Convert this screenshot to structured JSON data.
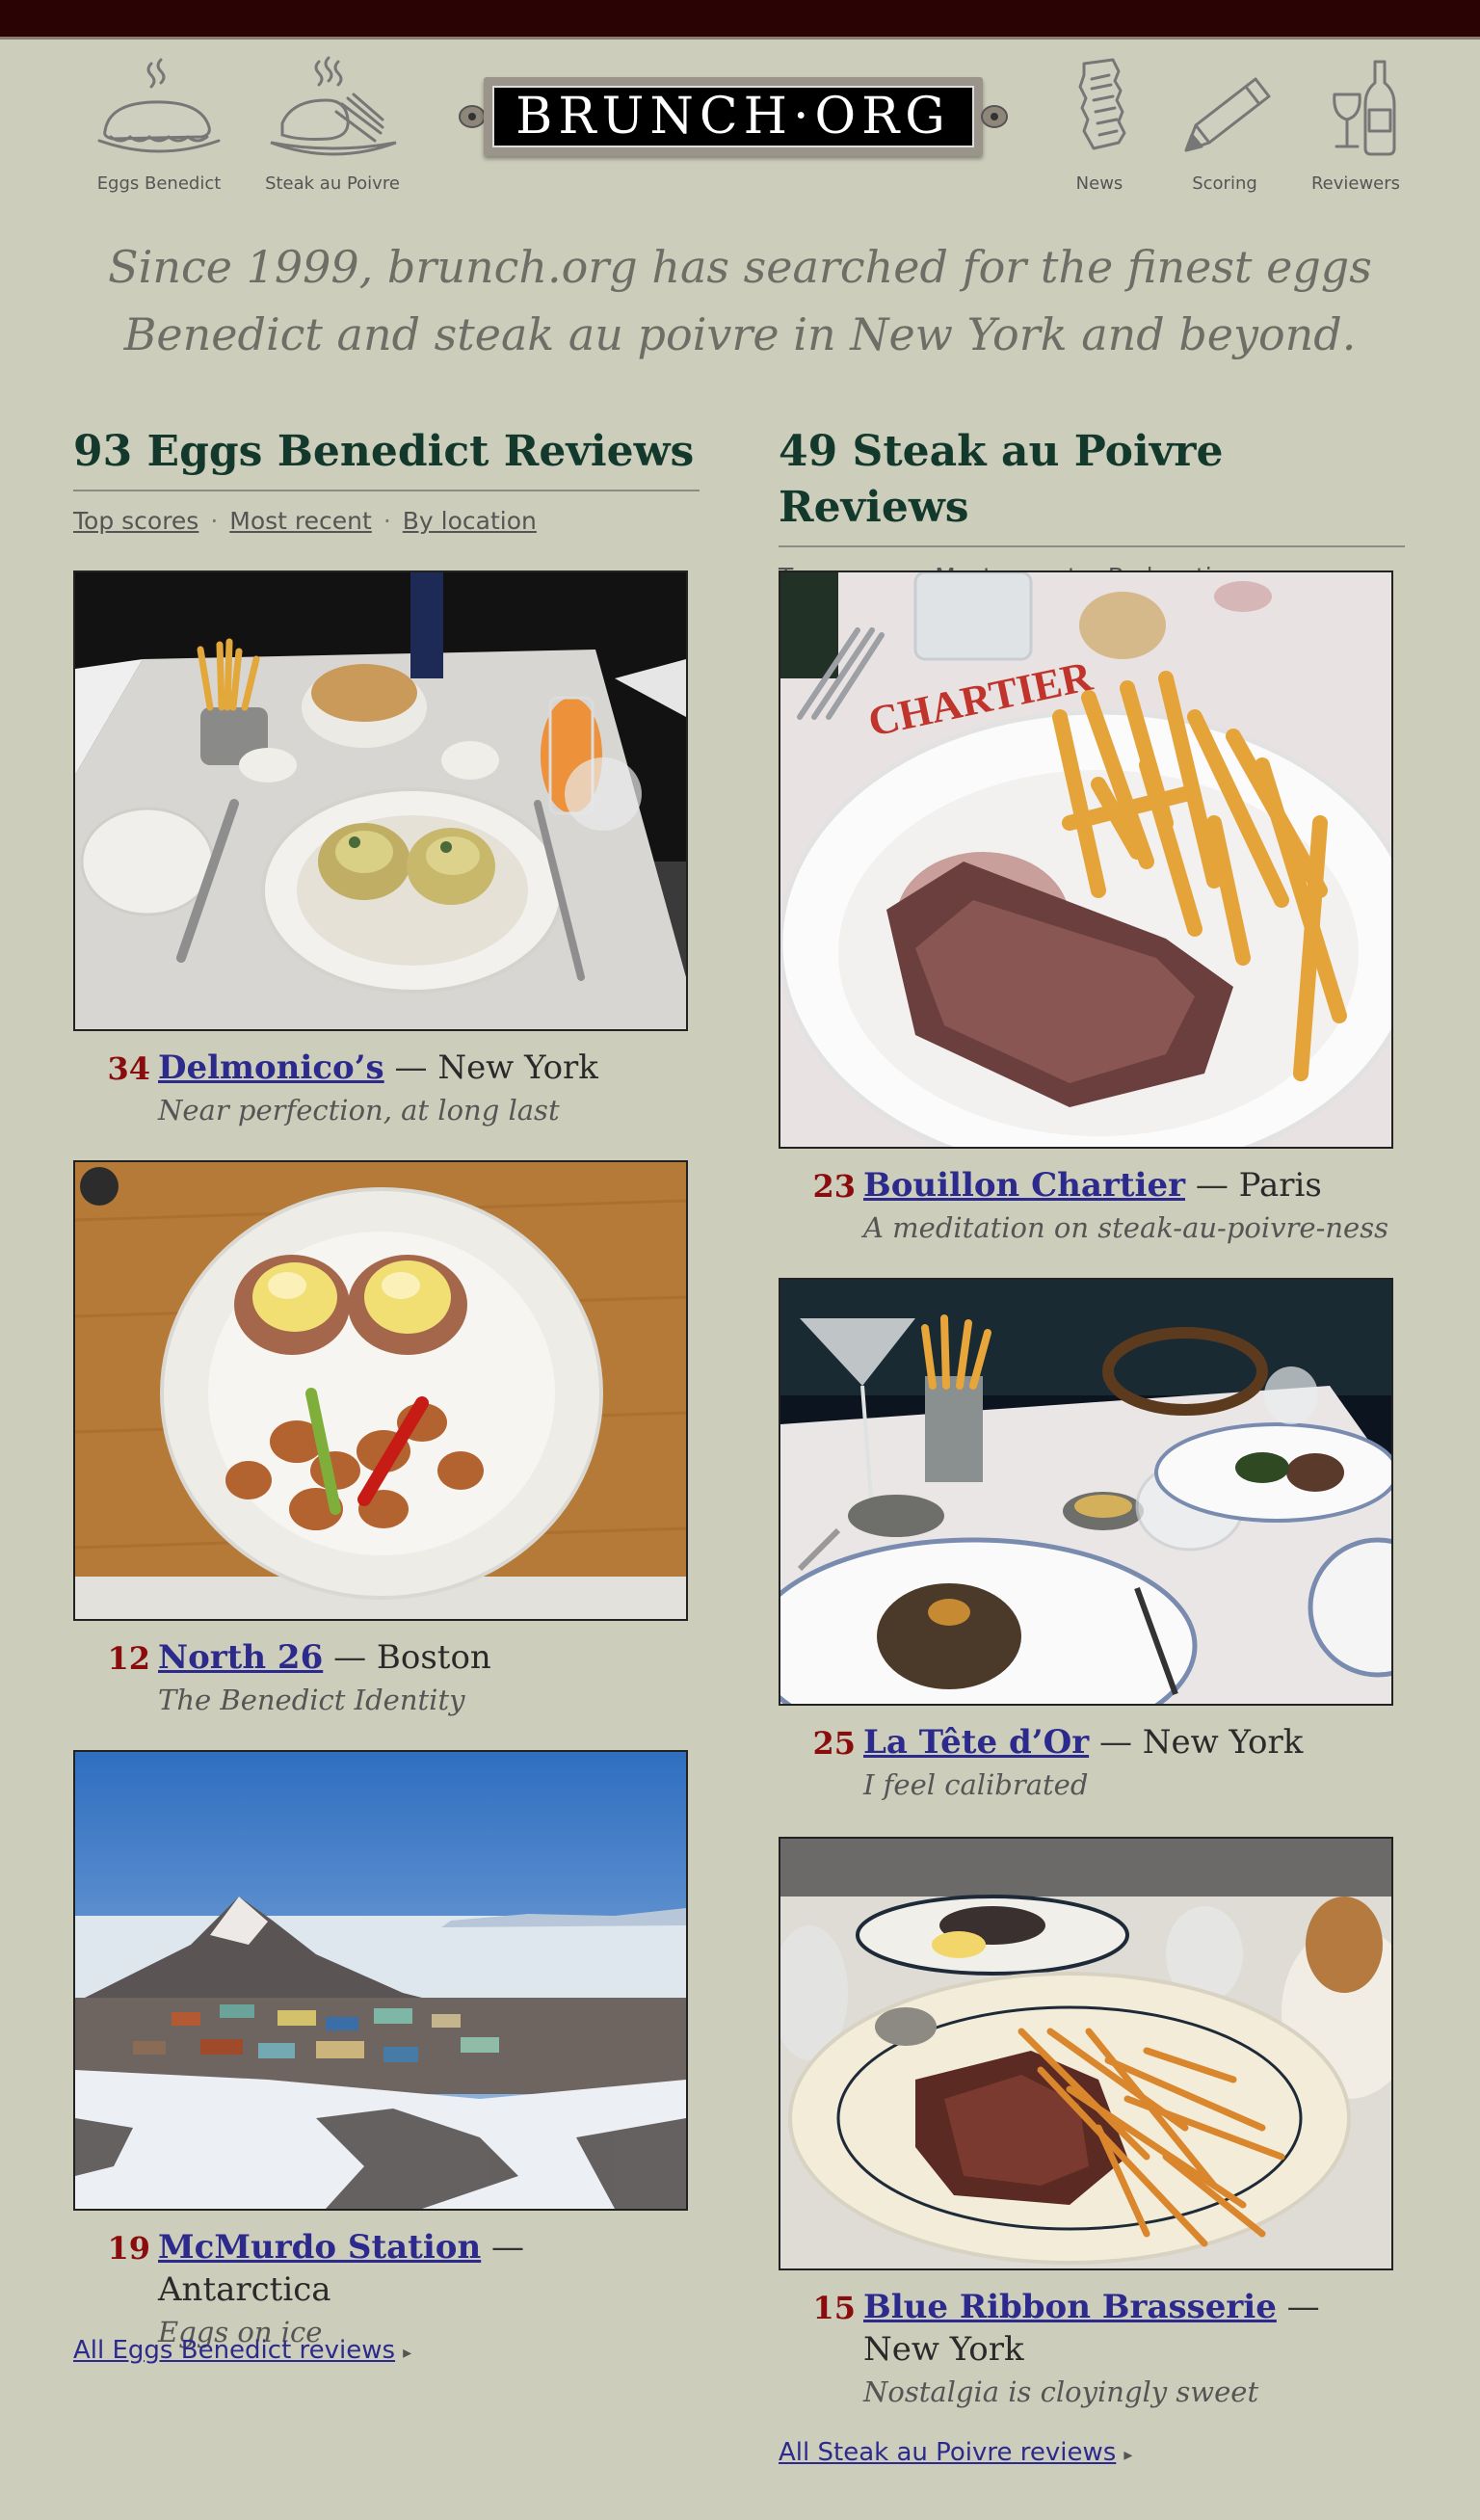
{
  "site": {
    "logo_text": "BRUNCH·ORG",
    "tagline_line1": "Since 1999, brunch.org has searched for the finest eggs",
    "tagline_line2": "Benedict and steak au poivre in New York and beyond."
  },
  "nav": {
    "eggs_benedict": "Eggs Benedict",
    "steak_au_poivre": "Steak au Poivre",
    "news": "News",
    "scoring": "Scoring",
    "reviewers": "Reviewers"
  },
  "eggs": {
    "title": "93 Eggs Benedict Reviews",
    "sort_top": "Top scores",
    "sort_recent": "Most recent",
    "sort_location": "By location",
    "sort_sep": "·",
    "reviews": [
      {
        "score": "34",
        "name": "Delmonico’s",
        "sep": "—",
        "city": "New York",
        "quote": "Near perfection, at long last"
      },
      {
        "score": "12",
        "name": "North 26",
        "sep": "—",
        "city": "Boston",
        "quote": "The Benedict Identity"
      },
      {
        "score": "19",
        "name": "McMurdo Station",
        "sep": "—",
        "city": "Antarctica",
        "quote": "Eggs on ice"
      }
    ],
    "all_link": "All Eggs Benedict reviews",
    "arrow": "▸"
  },
  "steak": {
    "title": "49 Steak au Poivre Reviews",
    "sort_top": "Top scores",
    "sort_recent": "Most recent",
    "sort_location": "By location",
    "sort_sep": "·",
    "reviews": [
      {
        "score": "23",
        "name": "Bouillon Chartier",
        "sep": "—",
        "city": "Paris",
        "quote": "A meditation on steak-au-poivre-ness"
      },
      {
        "score": "25",
        "name": "La Tête d’Or",
        "sep": "—",
        "city": "New York",
        "quote": "I feel calibrated"
      },
      {
        "score": "15",
        "name": "Blue Ribbon Brasserie",
        "sep": "—",
        "city": "New York",
        "quote": "Nostalgia is cloyingly sweet"
      }
    ],
    "all_link": "All Steak au Poivre reviews",
    "arrow": "▸",
    "plate_text": "CHARTIER"
  },
  "colors": {
    "background": "#cdcdbb",
    "top_bar": "#2a0404",
    "heading": "#12392b",
    "score": "#8b0c0c",
    "link": "#2c2a8c"
  }
}
